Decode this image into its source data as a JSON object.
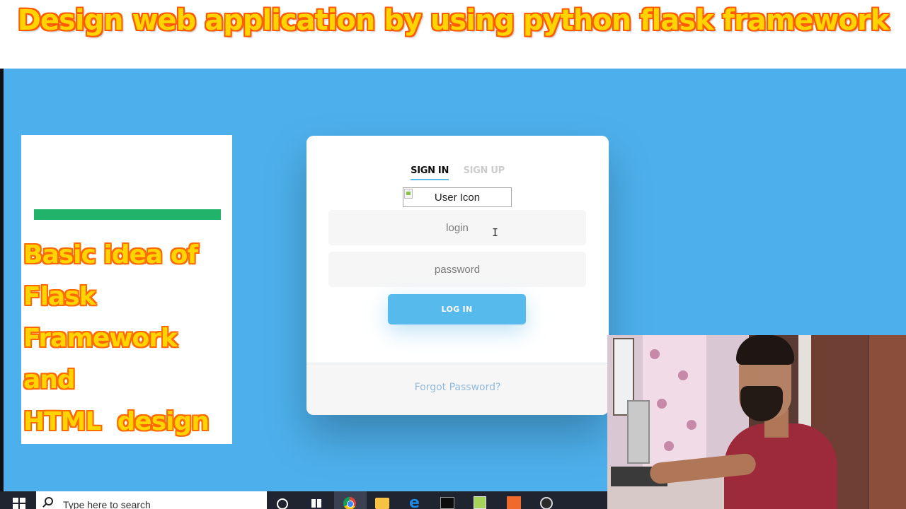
{
  "banner": {
    "title": "Design web application by using python flask framework"
  },
  "caption": {
    "lines": [
      "Basic idea of",
      "Flask",
      "Framework",
      "and",
      "HTML  design"
    ]
  },
  "login": {
    "tabs": [
      {
        "label": "SIGN IN",
        "active": true
      },
      {
        "label": "SIGN UP",
        "active": false
      }
    ],
    "user_icon_alt": "User Icon",
    "login_placeholder": "login",
    "password_placeholder": "password",
    "submit_label": "LOG IN",
    "forgot_label": "Forgot Password?"
  },
  "taskbar": {
    "search_placeholder": "Type here to search"
  },
  "colors": {
    "screen_background": "#4db0ec",
    "accent": "#56baed",
    "caption_bar": "#21b36a",
    "banner_fill": "#ffd400",
    "banner_outline": "#ff5a00"
  },
  "icons": [
    "windows-start-icon",
    "search-icon",
    "cortana-icon",
    "task-view-icon",
    "chrome-icon",
    "file-explorer-icon",
    "edge-icon",
    "terminal-icon",
    "notepad-icon",
    "pycharm-icon",
    "obs-icon"
  ]
}
